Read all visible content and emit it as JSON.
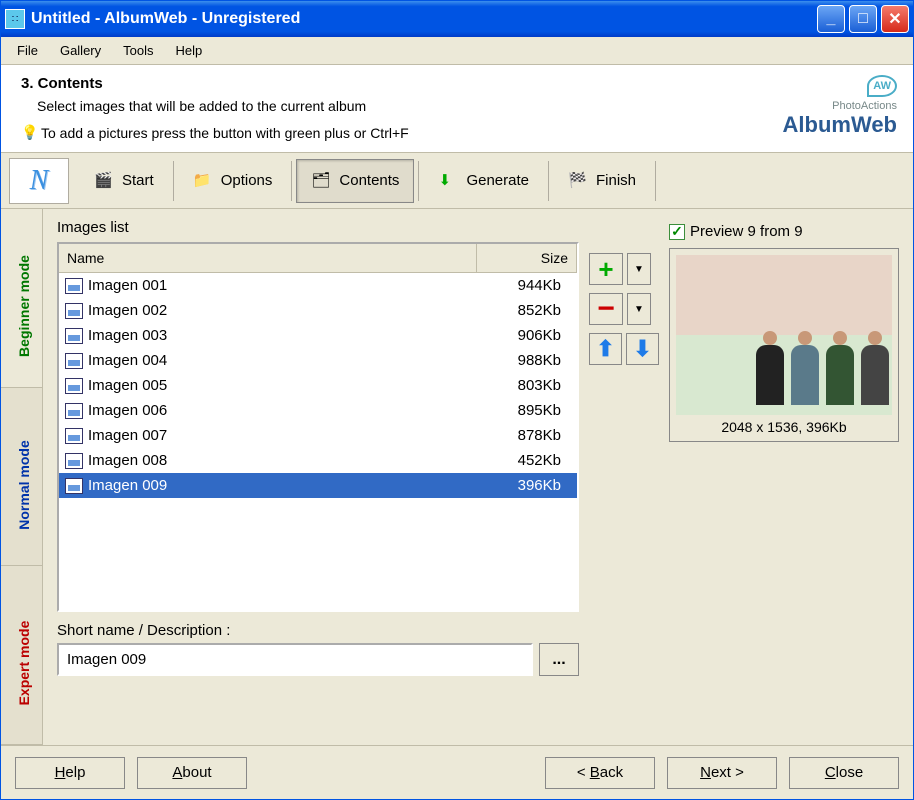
{
  "titlebar": {
    "title": "Untitled - AlbumWeb - Unregistered"
  },
  "menu": {
    "file": "File",
    "gallery": "Gallery",
    "tools": "Tools",
    "help": "Help"
  },
  "header": {
    "step_title": "3. Contents",
    "description": "Select images that will be added to the current album",
    "tip": "To add a pictures press the button with green plus or Ctrl+F",
    "brand_small": "PhotoActions",
    "brand_big": "AlbumWeb",
    "brand_badge": "AW"
  },
  "toolbar": {
    "start": "Start",
    "options": "Options",
    "contents": "Contents",
    "generate": "Generate",
    "finish": "Finish"
  },
  "sidetabs": {
    "beginner": "Beginner mode",
    "normal": "Normal mode",
    "expert": "Expert mode"
  },
  "images": {
    "label": "Images list",
    "col_name": "Name",
    "col_size": "Size",
    "rows": [
      {
        "name": "Imagen 001",
        "size": "944Kb"
      },
      {
        "name": "Imagen 002",
        "size": "852Kb"
      },
      {
        "name": "Imagen 003",
        "size": "906Kb"
      },
      {
        "name": "Imagen 004",
        "size": "988Kb"
      },
      {
        "name": "Imagen 005",
        "size": "803Kb"
      },
      {
        "name": "Imagen 006",
        "size": "895Kb"
      },
      {
        "name": "Imagen 007",
        "size": "878Kb"
      },
      {
        "name": "Imagen 008",
        "size": "452Kb"
      },
      {
        "name": "Imagen 009",
        "size": "396Kb"
      }
    ],
    "selected_index": 8
  },
  "shortname": {
    "label": "Short name / Description :",
    "value": "Imagen 009",
    "ellipsis": "..."
  },
  "preview": {
    "check_label": "Preview 9 from 9",
    "info": "2048 x 1536, 396Kb"
  },
  "footer": {
    "help": "Help",
    "about": "About",
    "back": "< Back",
    "next": "Next >",
    "close": "Close"
  }
}
